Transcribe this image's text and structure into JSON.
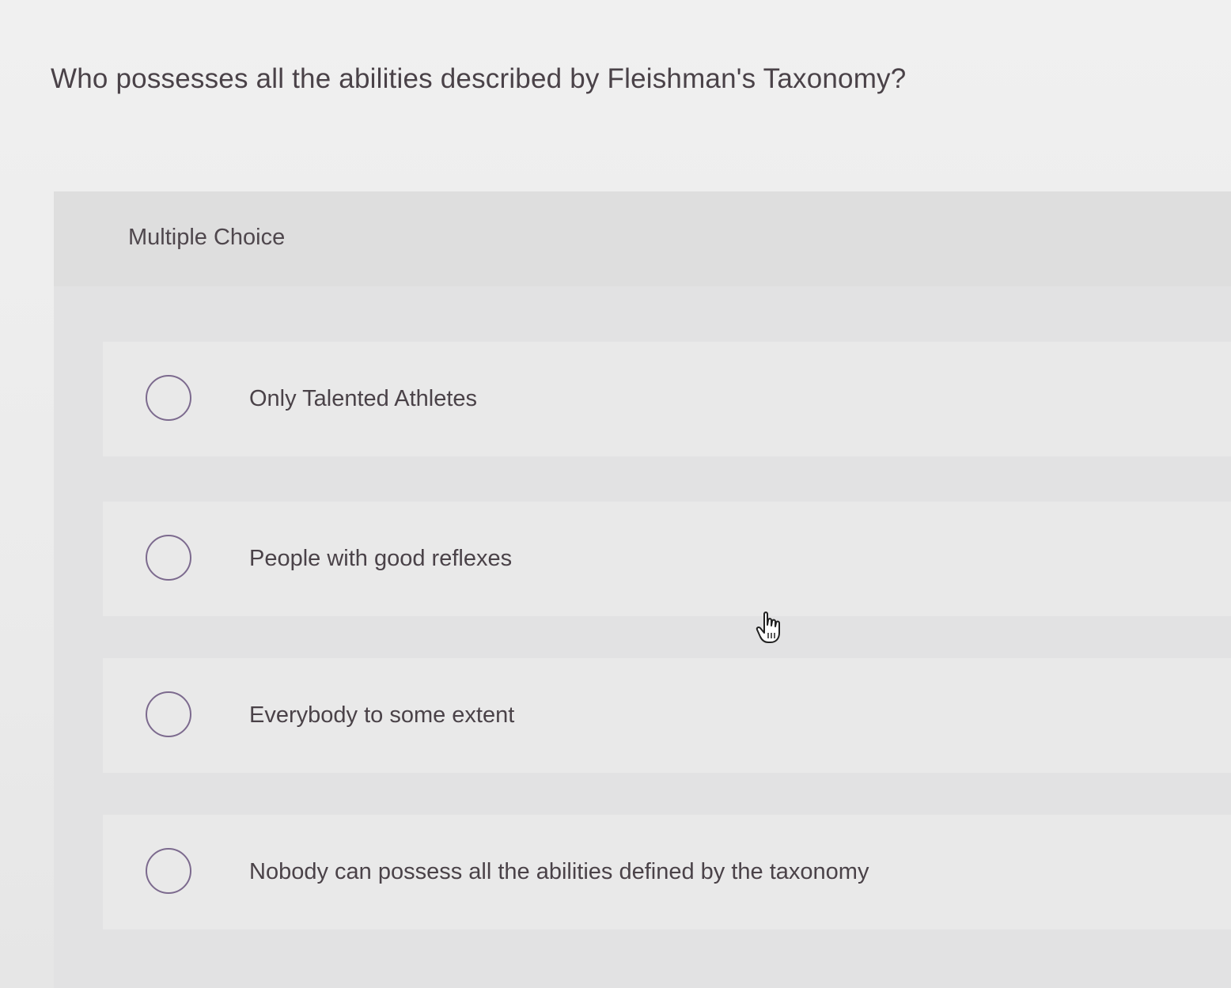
{
  "question": {
    "text": "Who possesses all the abilities described by Fleishman's Taxonomy?"
  },
  "panel": {
    "type_label": "Multiple Choice"
  },
  "options": [
    {
      "label": "Only Talented Athletes",
      "selected": false
    },
    {
      "label": "People with good reflexes",
      "selected": false
    },
    {
      "label": "Everybody to some extent",
      "selected": false
    },
    {
      "label": "Nobody can possess all the abilities defined by the taxonomy",
      "selected": false
    }
  ],
  "colors": {
    "radio_border": "#7c6a8e",
    "text": "#4a4248"
  },
  "icons": {
    "cursor": "hand-pointer-icon"
  }
}
